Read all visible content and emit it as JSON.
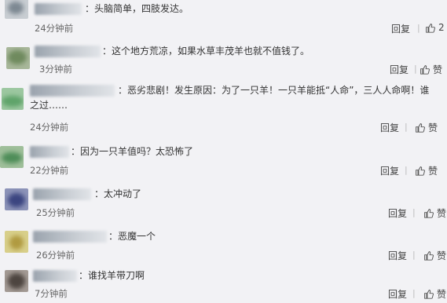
{
  "comments": [
    {
      "text": "：头脑简单，四肢发达。",
      "time": "24分钟前",
      "reply": "回复",
      "like": "2"
    },
    {
      "text": "：这个地方荒凉，如果水草丰茂羊也就不值钱了。",
      "time": "3分钟前",
      "reply": "回复",
      "like": "赞"
    },
    {
      "text": "：恶劣悲剧！发生原因：为了一只羊！一只羊能抵“人命”，三人人命啊！谁之过……",
      "time": "24分钟前",
      "reply": "回复",
      "like": "赞"
    },
    {
      "text": "：因为一只羊值吗？太恐怖了",
      "time": "22分钟前",
      "reply": "回复",
      "like": "赞"
    },
    {
      "text": "：太冲动了",
      "time": "25分钟前",
      "reply": "回复",
      "like": "赞"
    },
    {
      "text": "：恶魔一个",
      "time": "26分钟前",
      "reply": "回复",
      "like": "赞"
    },
    {
      "text": "：谁找羊带刀啊",
      "time": "7分钟前",
      "reply": "回复",
      "like": "赞"
    }
  ],
  "icons": {
    "like": "thumbs-up-icon"
  },
  "colors": {
    "background": "#f2f2f5",
    "text": "#333333",
    "muted": "#666666"
  }
}
